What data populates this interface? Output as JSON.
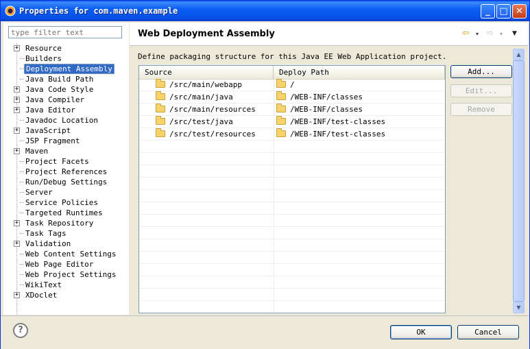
{
  "window": {
    "title": "Properties for com.maven.example"
  },
  "filter": {
    "placeholder": "type filter text"
  },
  "tree": [
    {
      "label": "Resource",
      "expandable": true
    },
    {
      "label": "Builders",
      "expandable": false
    },
    {
      "label": "Deployment Assembly",
      "expandable": false,
      "selected": true
    },
    {
      "label": "Java Build Path",
      "expandable": false
    },
    {
      "label": "Java Code Style",
      "expandable": true
    },
    {
      "label": "Java Compiler",
      "expandable": true
    },
    {
      "label": "Java Editor",
      "expandable": true
    },
    {
      "label": "Javadoc Location",
      "expandable": false
    },
    {
      "label": "JavaScript",
      "expandable": true
    },
    {
      "label": "JSP Fragment",
      "expandable": false
    },
    {
      "label": "Maven",
      "expandable": true
    },
    {
      "label": "Project Facets",
      "expandable": false
    },
    {
      "label": "Project References",
      "expandable": false
    },
    {
      "label": "Run/Debug Settings",
      "expandable": false
    },
    {
      "label": "Server",
      "expandable": false
    },
    {
      "label": "Service Policies",
      "expandable": false
    },
    {
      "label": "Targeted Runtimes",
      "expandable": false
    },
    {
      "label": "Task Repository",
      "expandable": true
    },
    {
      "label": "Task Tags",
      "expandable": false
    },
    {
      "label": "Validation",
      "expandable": true
    },
    {
      "label": "Web Content Settings",
      "expandable": false
    },
    {
      "label": "Web Page Editor",
      "expandable": false
    },
    {
      "label": "Web Project Settings",
      "expandable": false
    },
    {
      "label": "WikiText",
      "expandable": false
    },
    {
      "label": "XDoclet",
      "expandable": true
    }
  ],
  "page": {
    "title": "Web Deployment Assembly",
    "description": "Define packaging structure for this Java EE Web Application project."
  },
  "table": {
    "columns": [
      "Source",
      "Deploy Path"
    ],
    "rows": [
      {
        "source": "/src/main/webapp",
        "deploy": "/"
      },
      {
        "source": "/src/main/java",
        "deploy": "/WEB-INF/classes"
      },
      {
        "source": "/src/main/resources",
        "deploy": "/WEB-INF/classes"
      },
      {
        "source": "/src/test/java",
        "deploy": "/WEB-INF/test-classes"
      },
      {
        "source": "/src/test/resources",
        "deploy": "/WEB-INF/test-classes"
      }
    ],
    "empty_rows": 15
  },
  "buttons": {
    "add": "Add...",
    "edit": "Edit...",
    "remove": "Remove",
    "ok": "OK",
    "cancel": "Cancel"
  },
  "icons": {
    "help": "?",
    "back": "⇦",
    "forward": "⇨",
    "dropdown": "▾",
    "menu": "▼"
  }
}
